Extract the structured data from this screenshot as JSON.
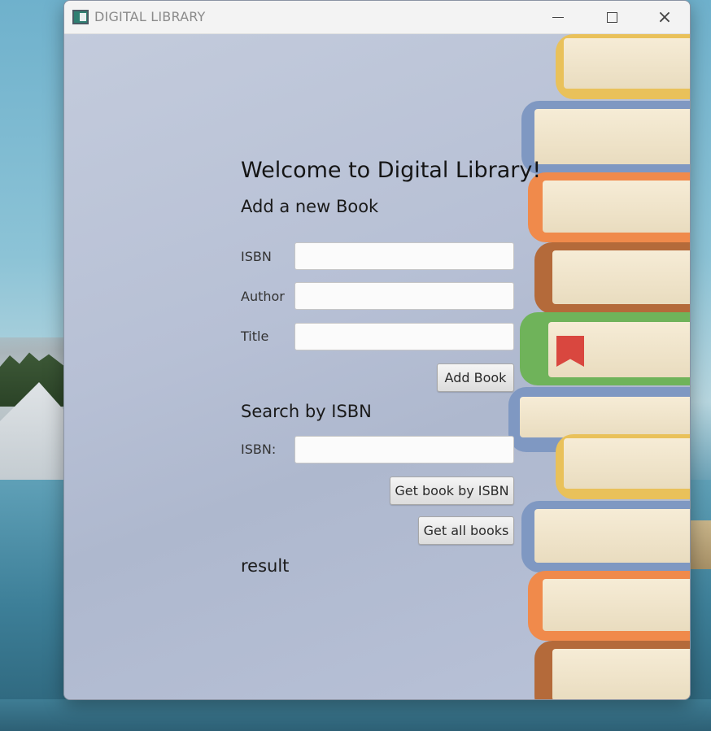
{
  "window": {
    "title": "DIGITAL LIBRARY",
    "controls": {
      "minimize": "minimize",
      "maximize": "maximize",
      "close": "×"
    }
  },
  "main": {
    "welcome": "Welcome to Digital Library!",
    "add_section": {
      "heading": "Add a new Book",
      "fields": [
        {
          "label": "ISBN",
          "value": ""
        },
        {
          "label": "Author",
          "value": ""
        },
        {
          "label": "Title",
          "value": ""
        }
      ],
      "add_button": "Add Book"
    },
    "search_section": {
      "heading": "Search by ISBN",
      "isbn_label": "ISBN:",
      "isbn_value": "",
      "get_by_isbn_button": "Get book by ISBN",
      "get_all_button": "Get all books"
    },
    "result_text": "result"
  },
  "icons": [
    "app-icon",
    "minimize-icon",
    "maximize-icon",
    "close-icon",
    "book-stack-image"
  ],
  "colors": {
    "window_background": "#b8c2d6",
    "titlebar": "#f3f3f3",
    "book_yellow": "#e9c15a",
    "book_blue": "#7f98c2",
    "book_orange": "#f08a4b",
    "book_brown": "#b46a3a",
    "book_green": "#6fb35a",
    "bookmark_red": "#d9473f"
  }
}
